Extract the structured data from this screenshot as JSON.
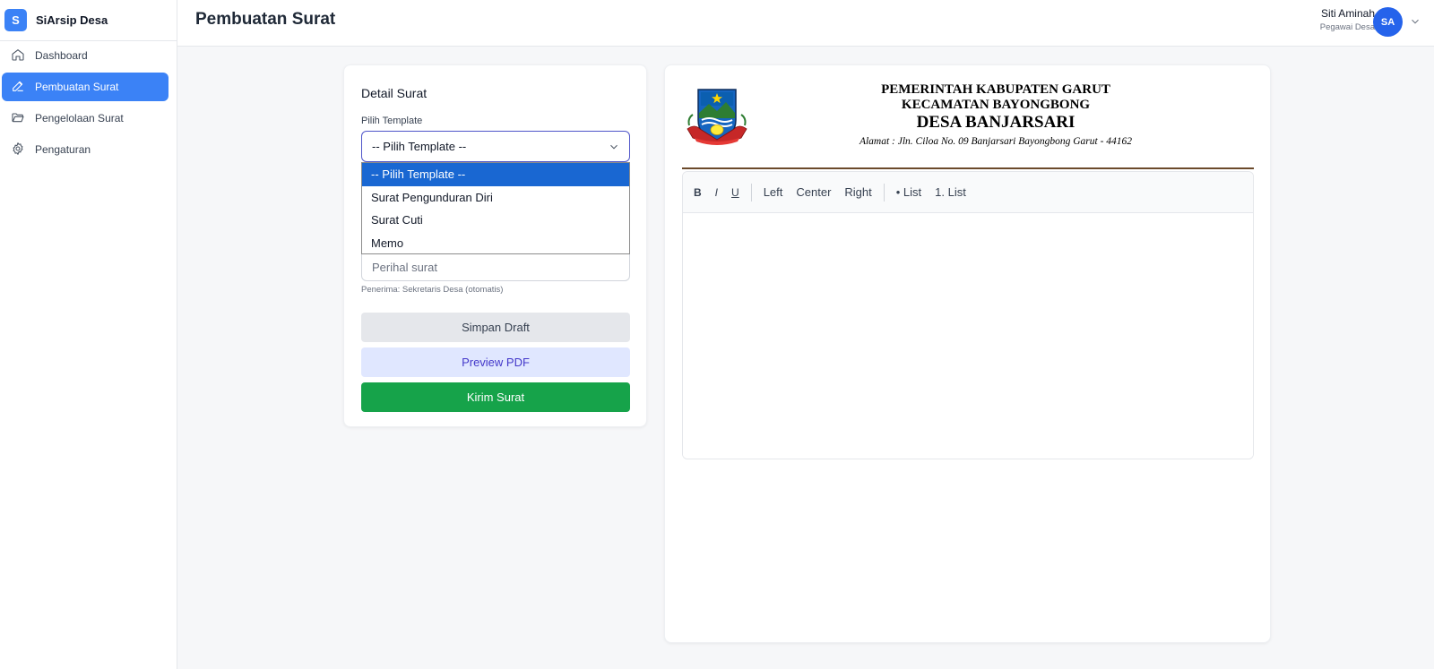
{
  "app": {
    "logo_letter": "S",
    "name": "SiArsip Desa"
  },
  "sidebar": {
    "items": [
      {
        "label": "Dashboard",
        "icon": "home-icon"
      },
      {
        "label": "Pembuatan Surat",
        "icon": "pencil-icon",
        "active": true
      },
      {
        "label": "Pengelolaan Surat",
        "icon": "folder-open-icon"
      },
      {
        "label": "Pengaturan",
        "icon": "gear-icon"
      }
    ]
  },
  "header": {
    "title": "Pembuatan Surat",
    "user": {
      "name": "Siti Aminah",
      "role": "Pegawai Desa",
      "initials": "SA"
    }
  },
  "detail": {
    "title": "Detail Surat",
    "template_label": "Pilih Template",
    "template_selected": "-- Pilih Template --",
    "template_options": [
      "-- Pilih Template --",
      "Surat Pengunduran Diri",
      "Surat Cuti",
      "Memo"
    ],
    "perihal_placeholder": "Perihal surat",
    "recipient_note": "Penerima: Sekretaris Desa (otomatis)",
    "buttons": {
      "draft": "Simpan Draft",
      "preview": "Preview PDF",
      "send": "Kirim Surat"
    }
  },
  "letterhead": {
    "line1": "PEMERINTAH KABUPATEN GARUT",
    "line2": "KECAMATAN BAYONGBONG",
    "line3": "DESA BANJARSARI",
    "address": "Alamat : Jln. Ciloa No. 09 Banjarsari Bayongbong Garut - 44162",
    "emblem_text": "GARUT NATA GIRIJAYA"
  },
  "editor": {
    "toolbar": {
      "bold": "B",
      "italic": "I",
      "underline": "U",
      "left": "Left",
      "center": "Center",
      "right": "Right",
      "bullet": "• List",
      "numbered": "1. List"
    },
    "content": ""
  },
  "colors": {
    "primary": "#3b82f6",
    "select_highlight": "#1967d2",
    "send": "#16a34a",
    "preview_bg": "#e0e7ff",
    "preview_text": "#4338ca"
  }
}
